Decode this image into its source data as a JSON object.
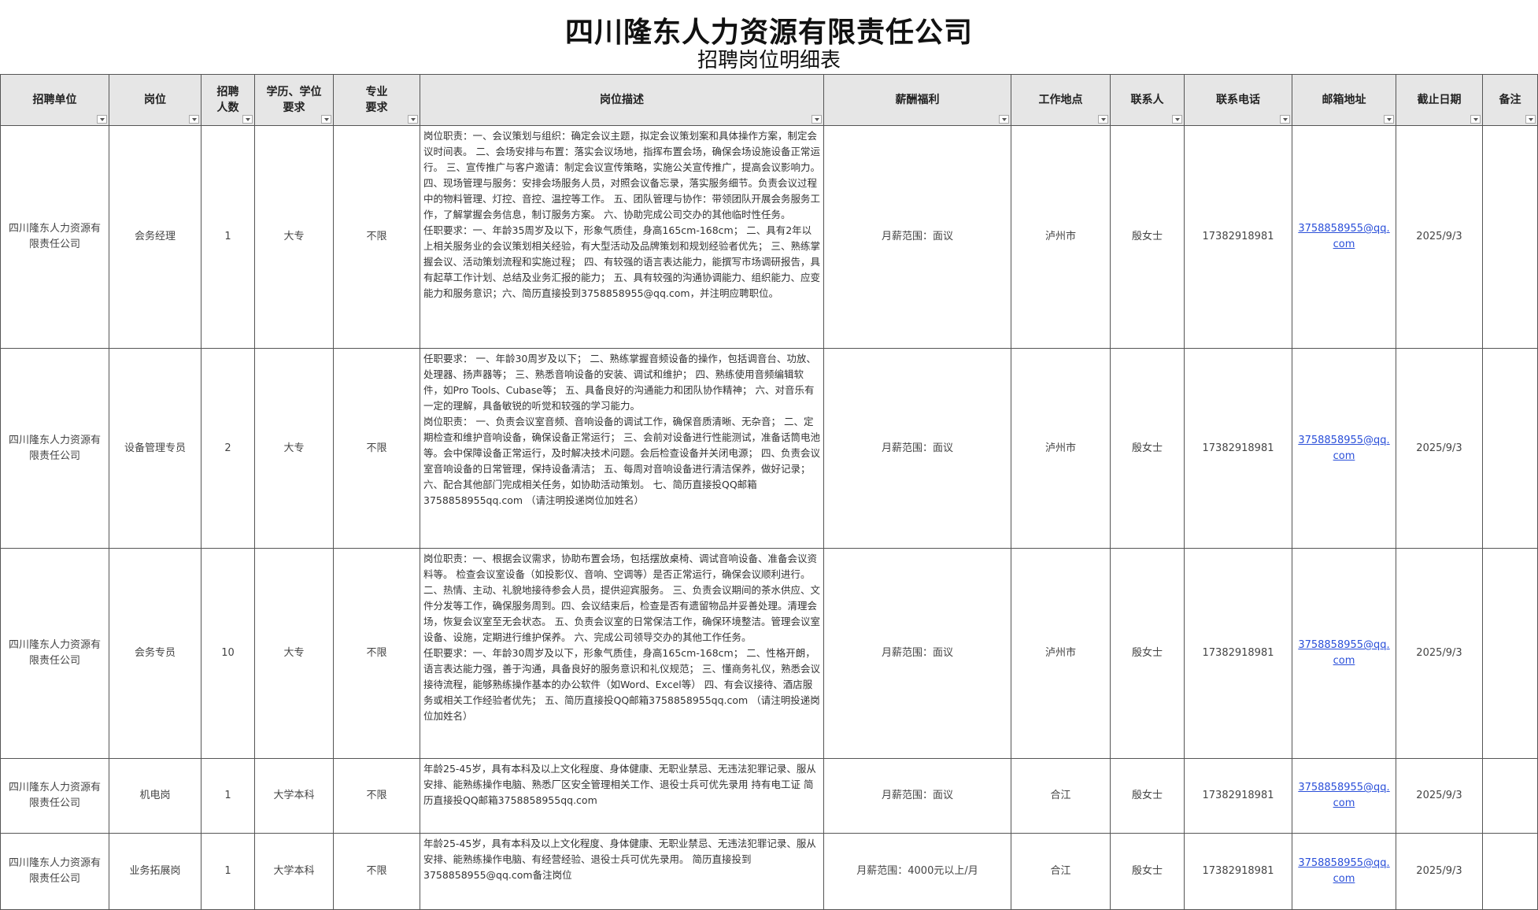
{
  "title": "四川隆东人力资源有限责任公司",
  "subtitle": "招聘岗位明细表",
  "headers": [
    "招聘单位",
    "岗位",
    "招聘\n人数",
    "学历、学位\n要求",
    "专业\n要求",
    "岗位描述",
    "薪酬福利",
    "工作地点",
    "联系人",
    "联系电话",
    "邮箱地址",
    "截止日期",
    "备注"
  ],
  "rows": [
    {
      "unit": "四川隆东人力资源有限责任公司",
      "position": "会务经理",
      "count": "1",
      "education": "大专",
      "major": "不限",
      "desc": [
        "岗位职责：一、会议策划与组织：确定会议主题，拟定会议策划案和具体操作方案，制定会议时间表。 二、会场安排与布置：落实会议场地，指挥布置会场，确保会场设施设备正常运行。 三、宣传推广与客户邀请：制定会议宣传策略，实施公关宣传推广，提高会议影响力。 四、现场管理与服务：安排会场服务人员，对照会议备忘录，落实服务细节。负责会议过程中的物料管理、灯控、音控、温控等工作。 五、团队管理与协作：带领团队开展会务服务工作，了解掌握会务信息，制订服务方案。 六、协助完成公司交办的其他临时性任务。",
        "任职要求：一、年龄35周岁及以下，形象气质佳，身高165cm-168cm； 二、具有2年以上相关服务业的会议策划相关经验，有大型活动及品牌策划和规划经验者优先； 三、熟练掌握会议、活动策划流程和实施过程； 四、有较强的语言表达能力，能撰写市场调研报告，具有起草工作计划、总结及业务汇报的能力； 五、具有较强的沟通协调能力、组织能力、应变能力和服务意识；六、简历直接投到3758858955@qq.com，并注明应聘职位。"
      ],
      "salary": "月薪范围：面议",
      "location": "泸州市",
      "contact": "殷女士",
      "phone": "17382918981",
      "email": "3758858955@qq.com",
      "deadline": "2025/9/3",
      "note": ""
    },
    {
      "unit": "四川隆东人力资源有限责任公司",
      "position": "设备管理专员",
      "count": "2",
      "education": "大专",
      "major": "不限",
      "desc": [
        "任职要求： 一、年龄30周岁及以下； 二、熟练掌握音频设备的操作，包括调音台、功放、处理器、扬声器等； 三、熟悉音响设备的安装、调试和维护； 四、熟练使用音频编辑软件，如Pro Tools、Cubase等； 五、具备良好的沟通能力和团队协作精神； 六、对音乐有一定的理解，具备敏锐的听觉和较强的学习能力。",
        "岗位职责： 一、负责会议室音频、音响设备的调试工作，确保音质清晰、无杂音； 二、定期检查和维护音响设备，确保设备正常运行； 三、会前对设备进行性能测试，准备话筒电池等。会中保障设备正常运行，及时解决技术问题。会后检查设备并关闭电源； 四、负责会议室音响设备的日常管理，保持设备清洁； 五、每周对音响设备进行清洁保养，做好记录； 六、配合其他部门完成相关任务，如协助活动策划。 七、简历直接投QQ邮箱3758858955qq.com （请注明投递岗位加姓名）"
      ],
      "salary": "月薪范围：面议",
      "location": "泸州市",
      "contact": "殷女士",
      "phone": "17382918981",
      "email": "3758858955@qq.com",
      "deadline": "2025/9/3",
      "note": ""
    },
    {
      "unit": "四川隆东人力资源有限责任公司",
      "position": "会务专员",
      "count": "10",
      "education": "大专",
      "major": "不限",
      "desc": [
        "岗位职责：一、根据会议需求，协助布置会场，包括摆放桌椅、调试音响设备、准备会议资料等。 检查会议室设备（如投影仪、音响、空调等）是否正常运行，确保会议顺利进行。 二、热情、主动、礼貌地接待参会人员，提供迎宾服务。 三、负责会议期间的茶水供应、文件分发等工作，确保服务周到。四、会议结束后，检查是否有遗留物品并妥善处理。清理会场，恢复会议室至无会状态。 五、负责会议室的日常保洁工作，确保环境整洁。管理会议室设备、设施，定期进行维护保养。 六、完成公司领导交办的其他工作任务。",
        "任职要求：一、年龄30周岁及以下，形象气质佳，身高165cm-168cm； 二、性格开朗，语言表达能力强，善于沟通，具备良好的服务意识和礼仪规范； 三、懂商务礼仪，熟悉会议接待流程，能够熟练操作基本的办公软件（如Word、Excel等） 四、有会议接待、酒店服务或相关工作经验者优先； 五、简历直接投QQ邮箱3758858955qq.com （请注明投递岗位加姓名）"
      ],
      "salary": "月薪范围：面议",
      "location": "泸州市",
      "contact": "殷女士",
      "phone": "17382918981",
      "email": "3758858955@qq.com",
      "deadline": "2025/9/3",
      "note": ""
    },
    {
      "unit": "四川隆东人力资源有限责任公司",
      "position": "机电岗",
      "count": "1",
      "education": "大学本科",
      "major": "不限",
      "desc": [
        "年龄25-45岁，具有本科及以上文化程度、身体健康、无职业禁忌、无违法犯罪记录、服从安排、能熟练操作电脑、熟悉厂区安全管理相关工作、退役士兵可优先录用 持有电工证 简历直接投QQ邮箱3758858955qq.com"
      ],
      "salary": "月薪范围：面议",
      "location": "合江",
      "contact": "殷女士",
      "phone": "17382918981",
      "email": "3758858955@qq.com",
      "deadline": "2025/9/3",
      "note": ""
    },
    {
      "unit": "四川隆东人力资源有限责任公司",
      "position": "业务拓展岗",
      "count": "1",
      "education": "大学本科",
      "major": "不限",
      "desc": [
        "年龄25-45岁，具有本科及以上文化程度、身体健康、无职业禁忌、无违法犯罪记录、服从安排、能熟练操作电脑、有经营经验、退役士兵可优先录用。 简历直接投到3758858955@qq.com备注岗位"
      ],
      "salary": "月薪范围：4000元以上/月",
      "location": "合江",
      "contact": "殷女士",
      "phone": "17382918981",
      "email": "3758858955@qq.com",
      "deadline": "2025/9/3",
      "note": ""
    }
  ]
}
